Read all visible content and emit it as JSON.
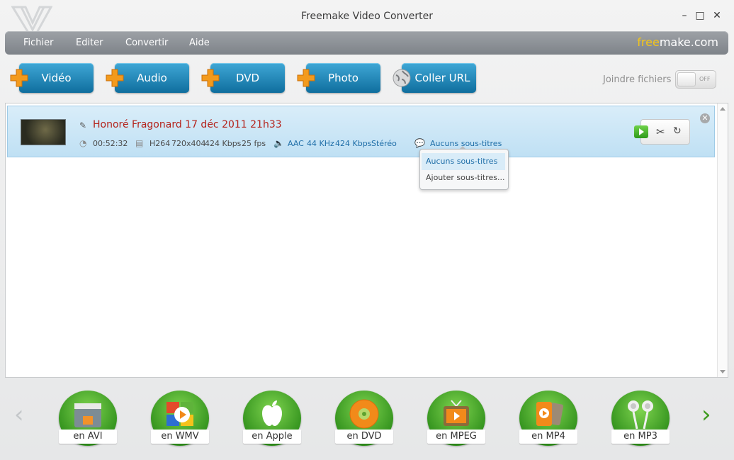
{
  "window": {
    "title": "Freemake Video Converter",
    "controls": {
      "minimize": "–",
      "maximize": "□",
      "close": "✕"
    }
  },
  "menu": {
    "items": [
      "Fichier",
      "Editer",
      "Convertir",
      "Aide"
    ],
    "brand_prefix": "free",
    "brand_suffix": "make.com"
  },
  "toolbar": {
    "buttons": [
      {
        "label": "Vidéo",
        "icon": "plus-icon"
      },
      {
        "label": "Audio",
        "icon": "plus-icon"
      },
      {
        "label": "DVD",
        "icon": "plus-icon"
      },
      {
        "label": "Photo",
        "icon": "plus-icon"
      },
      {
        "label": "Coller URL",
        "icon": "globe-icon"
      }
    ],
    "join_label": "Joindre fichiers",
    "toggle_state": "OFF"
  },
  "file": {
    "name": "Honoré Fragonard 17 déc 2011  21h33",
    "duration": "00:52:32",
    "video_codec": "H264",
    "resolution": "720x404",
    "video_bitrate": "424 Kbps",
    "fps": "25 fps",
    "audio_codec": "AAC",
    "sample_rate": "44 KHz",
    "audio_bitrate": "424 Kbps",
    "channels": "Stéréo",
    "subtitles": "Aucuns sous-titres"
  },
  "subtitle_dropdown": {
    "options": [
      "Aucuns sous-titres",
      "Ajouter sous-titres..."
    ],
    "selected_index": 0
  },
  "formats": [
    {
      "label": "en AVI",
      "icon": "clapperboard-icon"
    },
    {
      "label": "en WMV",
      "icon": "windows-media-icon"
    },
    {
      "label": "en Apple",
      "icon": "apple-icon"
    },
    {
      "label": "en DVD",
      "icon": "disc-icon"
    },
    {
      "label": "en MPEG",
      "icon": "tv-icon"
    },
    {
      "label": "en MP4",
      "icon": "media-player-icon"
    },
    {
      "label": "en MP3",
      "icon": "earphones-icon"
    }
  ],
  "colors": {
    "accent_blue": "#1578a8",
    "file_name_red": "#b4221b",
    "format_green": "#3e9b1f",
    "brand_yellow": "#f3c51a"
  }
}
